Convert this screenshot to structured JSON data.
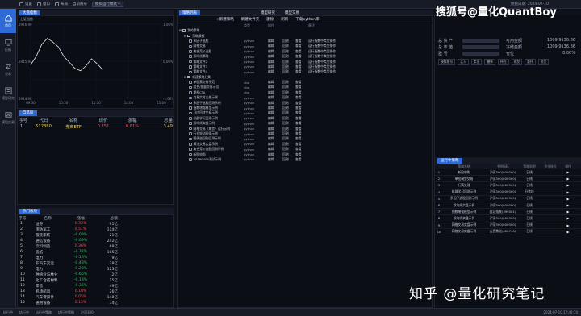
{
  "topbar": {
    "items": [
      "设置",
      "窗口",
      "布局"
    ],
    "account_label": "当前账号",
    "account_value": "模拟运行模式",
    "datetime": "数据日期: 2024-07-10"
  },
  "sidebar": {
    "items": [
      {
        "label": "首页",
        "icon": "home-icon"
      },
      {
        "label": "行情",
        "icon": "monitor-icon"
      },
      {
        "label": "交易",
        "icon": "trade-icon"
      },
      {
        "label": "模型研究",
        "icon": "research-icon"
      },
      {
        "label": "模型交易",
        "icon": "model-trade-icon"
      }
    ]
  },
  "chart_panel": {
    "tab": "大盘指数",
    "subtitle": "上证指数",
    "chart_data": {
      "type": "line",
      "title": "",
      "x": [
        "09:30",
        "10:30",
        "11:30",
        "14:00",
        "15:00"
      ],
      "ylim": [
        2914.98,
        2976.9
      ],
      "y_labels_left": [
        "2976.90",
        "2945.94",
        "2914.98"
      ],
      "y_labels_right": [
        "1.06%",
        "0.00%",
        "-1.06%"
      ],
      "series": [
        {
          "values": [
            2943,
            2950,
            2960,
            2965,
            2962,
            2958,
            2950,
            2945,
            2940,
            2938,
            2942,
            2948,
            2944,
            2939
          ]
        }
      ]
    }
  },
  "watch_panel": {
    "tab": "自选股",
    "headers": [
      "序号",
      "代码",
      "名称",
      "现价",
      "涨幅",
      "总量"
    ],
    "rows": [
      {
        "no": "1",
        "code": "512880",
        "name": "券商ETF",
        "price": "0.751",
        "chg": "0.81%",
        "vol": "3.49"
      }
    ]
  },
  "sector_panel": {
    "tab": "热门板块",
    "headers": [
      "序号",
      "名称",
      "涨幅",
      "总额"
    ],
    "rows": [
      {
        "no": "1",
        "name": "证券",
        "chg": "0.55%",
        "amt": "91亿",
        "color": "red"
      },
      {
        "no": "2",
        "name": "国防军工",
        "chg": "0.51%",
        "amt": "114亿",
        "color": "red"
      },
      {
        "no": "3",
        "name": "服装家纺",
        "chg": "-0.09%",
        "amt": "21亿",
        "color": "green"
      },
      {
        "no": "4",
        "name": "通信设备",
        "chg": "-0.09%",
        "amt": "242亿",
        "color": "green"
      },
      {
        "no": "5",
        "name": "饮料制造",
        "chg": "0.36%",
        "amt": "68亿",
        "color": "red"
      },
      {
        "no": "6",
        "name": "造纸",
        "chg": "-0.32%",
        "amt": "105亿",
        "color": "green"
      },
      {
        "no": "7",
        "name": "电力",
        "chg": "-0.16%",
        "amt": "9亿",
        "color": "green"
      },
      {
        "no": "8",
        "name": "非汽车交运",
        "chg": "-0.48%",
        "amt": "28亿",
        "color": "green"
      },
      {
        "no": "9",
        "name": "电力",
        "chg": "-0.28%",
        "amt": "123亿",
        "color": "green"
      },
      {
        "no": "10",
        "name": "种植业与林业",
        "chg": "-0.66%",
        "amt": "2亿",
        "color": "green"
      },
      {
        "no": "11",
        "name": "化工合成材料",
        "chg": "-0.18%",
        "amt": "15亿",
        "color": "green"
      },
      {
        "no": "12",
        "name": "零售",
        "chg": "-0.36%",
        "amt": "49亿",
        "color": "green"
      },
      {
        "no": "13",
        "name": "机场航运",
        "chg": "0.18%",
        "amt": "26亿",
        "color": "red"
      },
      {
        "no": "14",
        "name": "汽车零部件",
        "chg": "0.05%",
        "amt": "148亿",
        "color": "red"
      },
      {
        "no": "15",
        "name": "通用设备",
        "chg": "0.15%",
        "amt": "34亿",
        "color": "red"
      }
    ]
  },
  "strategy_panel": {
    "tab": "策略列表",
    "toolbar": [
      "+新建策略",
      "新建文件夹",
      "删除",
      "刷新",
      "下载python库"
    ],
    "col_headers": [
      "",
      "类型",
      "操作",
      "",
      "",
      "备注"
    ],
    "rows": [
      {
        "indent": 0,
        "kind": "folder",
        "name": "我的策略",
        "type": "",
        "ops": [],
        "note": ""
      },
      {
        "indent": 1,
        "kind": "folder",
        "name": "策略模板",
        "type": "",
        "ops": [],
        "note": ""
      },
      {
        "indent": 2,
        "kind": "file",
        "name": "多因子选股",
        "type": "python",
        "ops": [
          "编辑",
          "回测",
          "查看"
        ],
        "note": "运行指数中类型操作"
      },
      {
        "indent": 2,
        "kind": "file",
        "name": "网格交易",
        "type": "python",
        "ops": [
          "编辑",
          "回测",
          "查看"
        ],
        "note": "运行指数中类型操作"
      },
      {
        "indent": 2,
        "kind": "file",
        "name": "集合竞价选股",
        "type": "python",
        "ops": [
          "编辑",
          "回测",
          "查看"
        ],
        "note": "运行指数中类型操作"
      },
      {
        "indent": 2,
        "kind": "file",
        "name": "双均线策略",
        "type": "python",
        "ops": [
          "编辑",
          "回测",
          "查看"
        ],
        "note": "运行指数中类型操作"
      },
      {
        "indent": 2,
        "kind": "file",
        "name": "策略文件2",
        "type": "python",
        "ops": [
          "编辑",
          "回测",
          "查看"
        ],
        "note": "运行指数中类型操作"
      },
      {
        "indent": 2,
        "kind": "file",
        "name": "策略文件3",
        "type": "python",
        "ops": [
          "编辑",
          "回测",
          "查看"
        ],
        "note": "运行指数中类型操作"
      },
      {
        "indent": 2,
        "kind": "file",
        "name": "策略文件4",
        "type": "python",
        "ops": [
          "编辑",
          "回测",
          "查看"
        ],
        "note": "运行指数中类型操作"
      },
      {
        "indent": 1,
        "kind": "folder",
        "name": "新建策略分类",
        "type": "",
        "ops": [],
        "note": ""
      },
      {
        "indent": 2,
        "kind": "file",
        "name": "单股票交易示范",
        "type": "vba",
        "ops": [
          "编辑",
          "回测",
          "查看"
        ],
        "note": ""
      },
      {
        "indent": 2,
        "kind": "file",
        "name": "组合/批量交易示范",
        "type": "vba",
        "ops": [
          "编辑",
          "回测",
          "查看"
        ],
        "note": ""
      },
      {
        "indent": 2,
        "kind": "file",
        "name": "期权CTA",
        "type": "vba",
        "ops": [
          "编辑",
          "回测",
          "查看"
        ],
        "note": ""
      },
      {
        "indent": 2,
        "kind": "file",
        "name": "交易实时主推示例",
        "type": "python",
        "ops": [
          "编辑",
          "回测",
          "查看"
        ],
        "note": ""
      },
      {
        "indent": 2,
        "kind": "file",
        "name": "多因子选股回测示例",
        "type": "python",
        "ops": [
          "编辑",
          "回测",
          "查看"
        ],
        "note": ""
      },
      {
        "indent": 2,
        "kind": "file",
        "name": "指数增强模型示例",
        "type": "python",
        "ops": [
          "编辑",
          "回测",
          "查看"
        ],
        "note": ""
      },
      {
        "indent": 2,
        "kind": "file",
        "name": "日内回转交易示例",
        "type": "python",
        "ops": [
          "编辑",
          "回测",
          "查看"
        ],
        "note": ""
      },
      {
        "indent": 2,
        "kind": "file",
        "name": "机器学习回测示例",
        "type": "python",
        "ops": [
          "编辑",
          "回测",
          "查看"
        ],
        "note": ""
      },
      {
        "indent": 2,
        "kind": "file",
        "name": "双均线实盘示例",
        "type": "python",
        "ops": [
          "编辑",
          "回测",
          "查看"
        ],
        "note": ""
      },
      {
        "indent": 2,
        "kind": "file",
        "name": "网格交易（期货）运行示例",
        "type": "python",
        "ops": [
          "编辑",
          "回测",
          "查看"
        ],
        "note": ""
      },
      {
        "indent": 2,
        "kind": "file",
        "name": "行业轮动回测示例",
        "type": "python",
        "ops": [
          "编辑",
          "回测",
          "查看"
        ],
        "note": ""
      },
      {
        "indent": 2,
        "kind": "file",
        "name": "国债逆回购回测示例",
        "type": "python",
        "ops": [
          "编辑",
          "回测",
          "查看"
        ],
        "note": ""
      },
      {
        "indent": 2,
        "kind": "file",
        "name": "算法交易实盘示例",
        "type": "python",
        "ops": [
          "编辑",
          "回测",
          "查看"
        ],
        "note": ""
      },
      {
        "indent": 2,
        "kind": "file",
        "name": "集合竞价选股回测示例",
        "type": "python",
        "ops": [
          "编辑",
          "回测",
          "查看"
        ],
        "note": ""
      },
      {
        "indent": 2,
        "kind": "file",
        "name": "新股申购",
        "type": "python",
        "ops": [
          "编辑",
          "回测",
          "查看"
        ],
        "note": ""
      },
      {
        "indent": 2,
        "kind": "file",
        "name": "20190404测试示例",
        "type": "python",
        "ops": [
          "编辑",
          "回测",
          "查看"
        ],
        "note": ""
      }
    ]
  },
  "model_tabs": [
    "模型研究",
    "模型交易"
  ],
  "account_panel": {
    "rows": [
      {
        "l1": "总 资 产",
        "v1": "",
        "l2": "可用金额",
        "v2": "1009 9136.86"
      },
      {
        "l1": "总 市 值",
        "v1": "",
        "l2": "冻结金额",
        "v2": "1009 9136.86"
      },
      {
        "l1": "盈 亏",
        "v1": "",
        "l2": "仓位",
        "v2": "0.00%"
      }
    ],
    "controls": [
      "模拟账号",
      "买入",
      "卖出",
      "撤单",
      "持仓",
      "成交",
      "委托",
      "资金"
    ]
  },
  "orders_panel": {
    "tab": "运行中策略",
    "headers": [
      "",
      "策略名称",
      "主图指标",
      "",
      "策略周期",
      "资金账号",
      "操作"
    ],
    "rows": [
      {
        "no": "1",
        "name": "新股申购",
        "code": "沪深300(000300)",
        "period": "日线",
        "acc": "",
        "op": "▶"
      },
      {
        "no": "2",
        "name": "单股模型交易",
        "code": "沪深300(000300)",
        "period": "日线",
        "acc": "",
        "op": "▶"
      },
      {
        "no": "3",
        "name": "行情处理",
        "code": "沪深300(000300)",
        "period": "日线",
        "acc": "",
        "op": "▶"
      },
      {
        "no": "4",
        "name": "机器学习回测示例",
        "code": "沪深300(000300)",
        "period": "分笔线",
        "acc": "",
        "op": "▶"
      },
      {
        "no": "5",
        "name": "多因子选股回测示例",
        "code": "沪深300(000300)",
        "period": "日线",
        "acc": "",
        "op": "▶"
      },
      {
        "no": "6",
        "name": "双均线实盘示例",
        "code": "沪深300(000300)",
        "period": "日线",
        "acc": "",
        "op": "▶"
      },
      {
        "no": "7",
        "name": "指数增强模型示例",
        "code": "国证指数(399001)",
        "period": "日线",
        "acc": "",
        "op": "▶"
      },
      {
        "no": "8",
        "name": "双均线实盘示例",
        "code": "沪深300(000300)",
        "period": "日线",
        "acc": "",
        "op": "▶"
      },
      {
        "no": "9",
        "name": "网格交易实盘示例",
        "code": "沪深300(000300)",
        "period": "日线",
        "acc": "",
        "op": "▶"
      },
      {
        "no": "10",
        "name": "网格交易实盘示例",
        "code": "山西焦化(600740)",
        "period": "日线",
        "acc": "",
        "op": "▶"
      }
    ]
  },
  "statusbar": {
    "items": [
      "执行中",
      "执行中",
      "执行中策略",
      "执行中策略",
      "沪深300",
      "2024-07-10 17:42:10"
    ]
  },
  "watermarks": {
    "top": "搜狐号@量化QuantBoy",
    "bottom": "知乎 @量化研究笔记"
  }
}
